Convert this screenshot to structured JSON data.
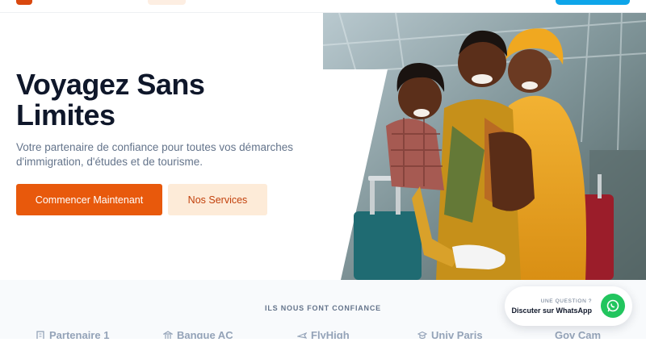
{
  "hero": {
    "title": "Voyagez Sans Limites",
    "subtitle": "Votre partenaire de confiance pour toutes vos démarches d'immigration, d'études et de tourisme.",
    "primary_button": "Commencer Maintenant",
    "secondary_button": "Nos Services"
  },
  "trust": {
    "title": "ILS NOUS FONT CONFIANCE",
    "partners": [
      {
        "label": "Partenaire 1",
        "icon": "building-icon"
      },
      {
        "label": "Banque AC",
        "icon": "bank-icon"
      },
      {
        "label": "FlyHigh",
        "icon": "plane-icon"
      },
      {
        "label": "Univ Paris",
        "icon": "graduation-cap-icon"
      },
      {
        "label": "Gov Cam",
        "icon": ""
      }
    ]
  },
  "whatsapp": {
    "question": "UNE QUESTION ?",
    "label": "Discuter sur WhatsApp",
    "icon": "whatsapp-icon"
  },
  "colors": {
    "primary": "#e8590c",
    "secondary_bg": "#fdebd8",
    "accent_blue": "#0ea5e9",
    "whatsapp": "#22c55e"
  }
}
